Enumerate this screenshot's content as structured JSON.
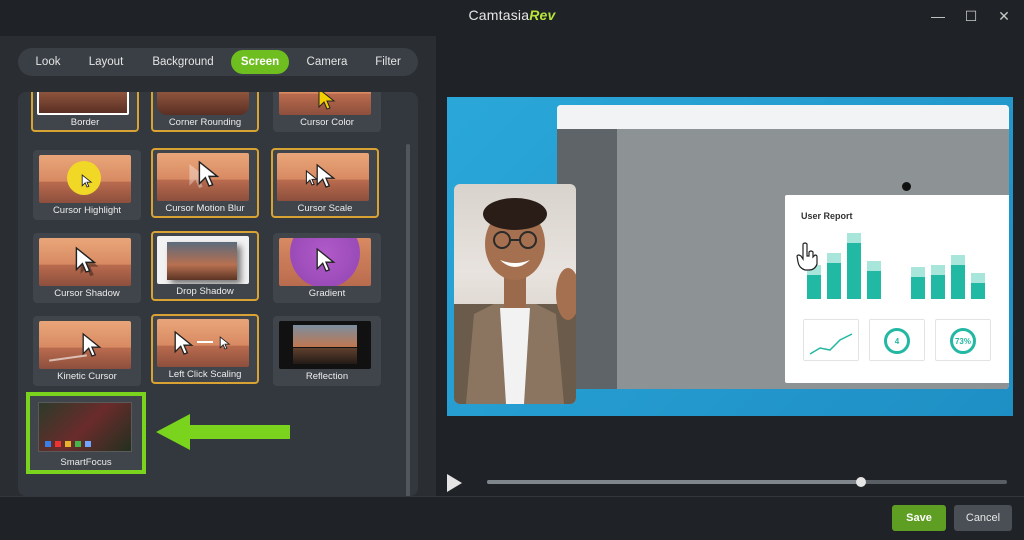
{
  "window": {
    "title_main": "Camtasia",
    "title_brand": "Rev",
    "minimize": "—",
    "maximize": "☐",
    "close": "✕"
  },
  "tabs": [
    {
      "label": "Look"
    },
    {
      "label": "Layout"
    },
    {
      "label": "Background"
    },
    {
      "label": "Screen",
      "active": true
    },
    {
      "label": "Camera"
    },
    {
      "label": "Filter"
    }
  ],
  "effects": [
    {
      "label": "Border",
      "selected": true
    },
    {
      "label": "Corner Rounding",
      "selected": true
    },
    {
      "label": "Cursor Color",
      "selected": false
    },
    {
      "label": "Cursor Highlight",
      "selected": false
    },
    {
      "label": "Cursor Motion Blur",
      "selected": true
    },
    {
      "label": "Cursor Scale",
      "selected": true
    },
    {
      "label": "Cursor Shadow",
      "selected": false
    },
    {
      "label": "Drop Shadow",
      "selected": true
    },
    {
      "label": "Gradient",
      "selected": false
    },
    {
      "label": "Kinetic Cursor",
      "selected": false
    },
    {
      "label": "Left Click Scaling",
      "selected": true
    },
    {
      "label": "Reflection",
      "selected": false
    },
    {
      "label": "SmartFocus",
      "selected": false,
      "highlighted": true
    }
  ],
  "preview": {
    "report_title": "User Report",
    "ring_a": "4",
    "ring_b": "73%"
  },
  "playback": {
    "progress": 0.72
  },
  "footer": {
    "save": "Save",
    "cancel": "Cancel"
  },
  "colors": {
    "accent": "#6fbe1f",
    "selected_border": "#d9a334",
    "highlight_border": "#7ad31c"
  }
}
